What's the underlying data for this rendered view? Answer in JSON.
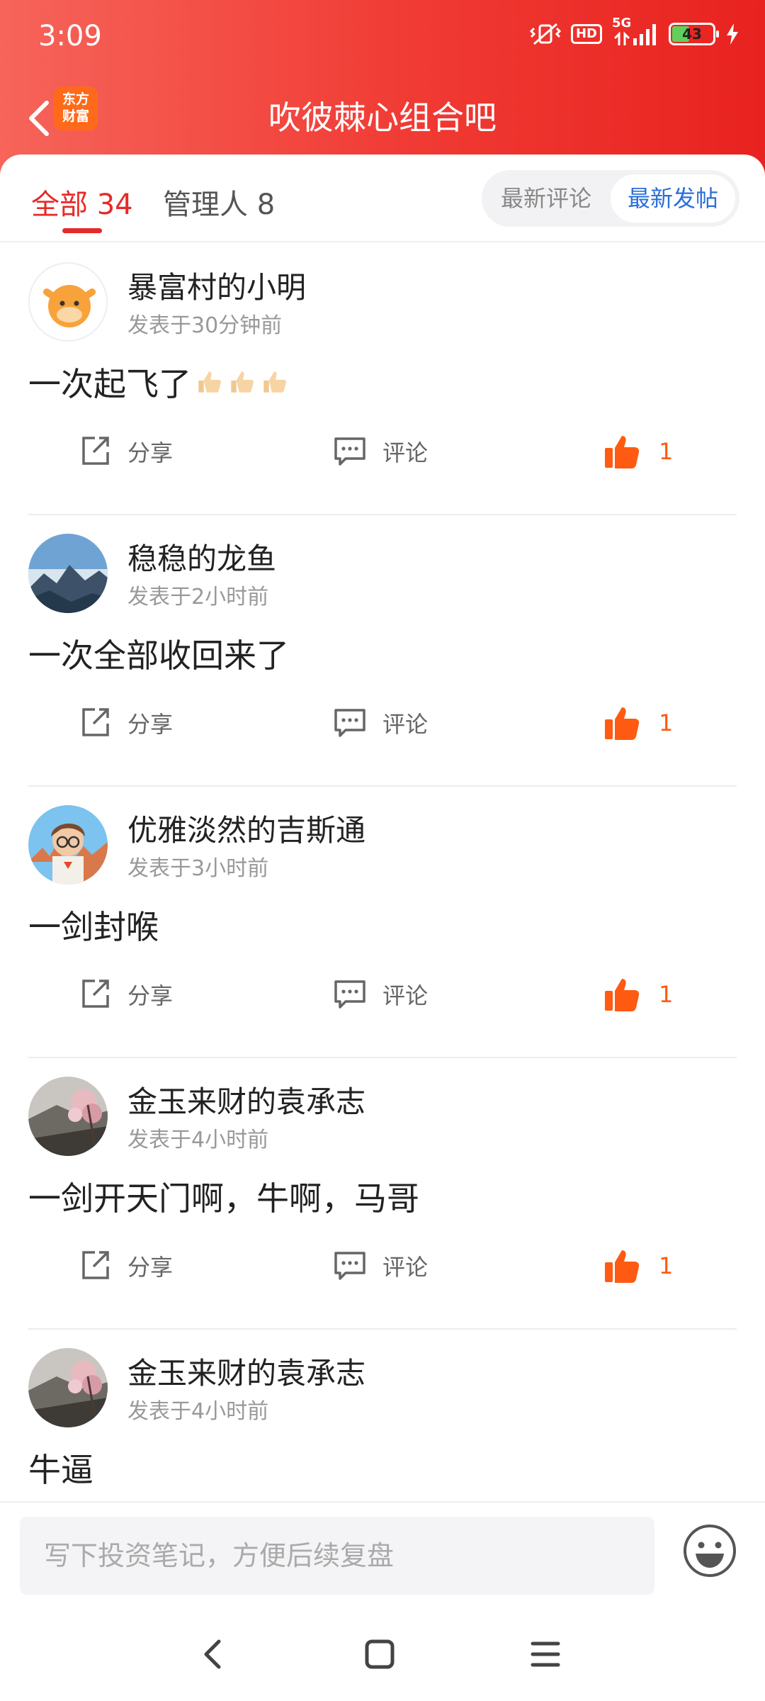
{
  "status_bar": {
    "time": "3:09",
    "hd": "HD",
    "network": "5G",
    "battery": "43"
  },
  "nav": {
    "logo_line1": "东方",
    "logo_line2": "财富",
    "title": "吹彼棘心组合吧"
  },
  "tabs": {
    "all": "全部 34",
    "managers": "管理人 8"
  },
  "sort": {
    "latest_comment": "最新评论",
    "latest_post": "最新发帖"
  },
  "actions": {
    "share": "分享",
    "comment": "评论"
  },
  "posts": [
    {
      "username": "暴富村的小明",
      "time": "发表于30分钟前",
      "content": "一次起飞了",
      "likes": "1"
    },
    {
      "username": "稳稳的龙鱼",
      "time": "发表于2小时前",
      "content": "一次全部收回来了",
      "likes": "1"
    },
    {
      "username": "优雅淡然的吉斯通",
      "time": "发表于3小时前",
      "content": "一剑封喉",
      "likes": "1"
    },
    {
      "username": "金玉来财的袁承志",
      "time": "发表于4小时前",
      "content": "一剑开天门啊，牛啊，马哥",
      "likes": "1"
    },
    {
      "username": "金玉来财的袁承志",
      "time": "发表于4小时前",
      "content": "牛逼"
    }
  ],
  "input": {
    "placeholder": "写下投资笔记，方便后续复盘"
  },
  "colors": {
    "header_red": "#f03a33",
    "accent_red": "#e62a28",
    "like_orange": "#ff5a12",
    "link_blue": "#2a6fd8"
  }
}
